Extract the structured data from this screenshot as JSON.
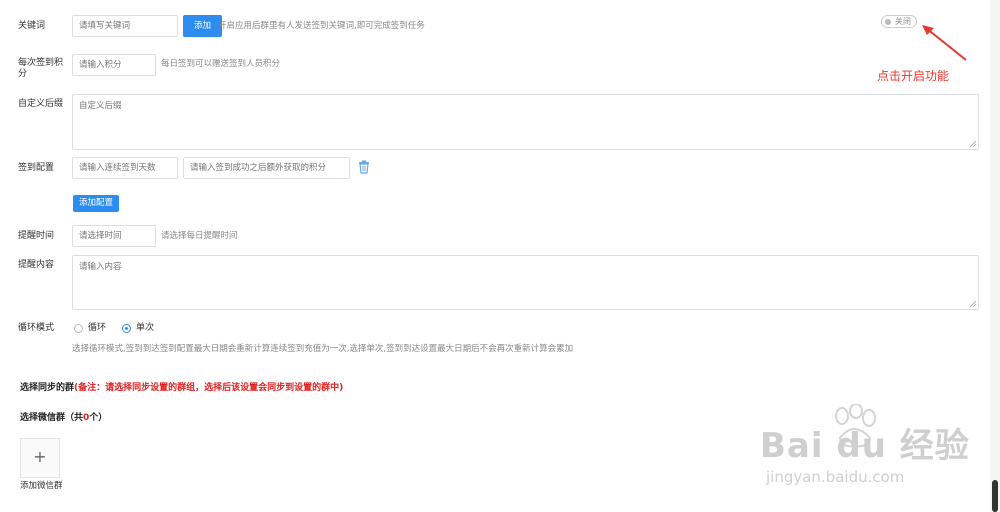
{
  "keyword": {
    "label": "关键词",
    "placeholder": "请填写关键词",
    "add_button": "添加",
    "hint": "开启应用后群里有人发送签到关键词,即可完成签到任务",
    "toggle_text": "关闭"
  },
  "points": {
    "label": "每次签到积分",
    "placeholder": "请输入积分",
    "hint": "每日签到可以赠送签到人员积分"
  },
  "custom_suffix": {
    "label": "自定义后缀",
    "placeholder": "自定义后缀"
  },
  "sign_config": {
    "label": "签到配置",
    "days_placeholder": "请输入连续签到天数",
    "extra_points_placeholder": "请输入签到成功之后额外获取的积分",
    "add_button": "添加配置"
  },
  "remind_time": {
    "label": "提醒时间",
    "placeholder": "请选择时间",
    "hint": "请选择每日提醒时间"
  },
  "remind_content": {
    "label": "提醒内容",
    "placeholder": "请输入内容"
  },
  "loop_mode": {
    "label": "循环模式",
    "options": [
      "循环",
      "单次"
    ],
    "selected": "单次",
    "hint": "选择循环模式,签到到达签到配置最大日期会重新计算连续签到充值为一次,选择单次,签到到达设置最大日期后不会再次重新计算会累加"
  },
  "sync_group": {
    "title": "选择同步的群",
    "note": "(备注：请选择同步设置的群组，选择后该设置会同步到设置的群中)",
    "wechat_label_prefix": "选择微信群（共",
    "wechat_count": "0",
    "wechat_label_suffix": "个）",
    "add_group_label": "添加微信群",
    "add_icon": "+"
  },
  "annotation": {
    "text": "点击开启功能",
    "color": "#e8382c"
  },
  "watermark": {
    "brand": "Bai du 经验",
    "url": "jingyan.baidu.com"
  },
  "colors": {
    "primary": "#2d8cf0",
    "danger": "#e02020",
    "arrow": "#e8382c"
  },
  "icons": {
    "delete": "trash-icon",
    "resize": "resize-handle-icon",
    "add": "plus-icon"
  }
}
